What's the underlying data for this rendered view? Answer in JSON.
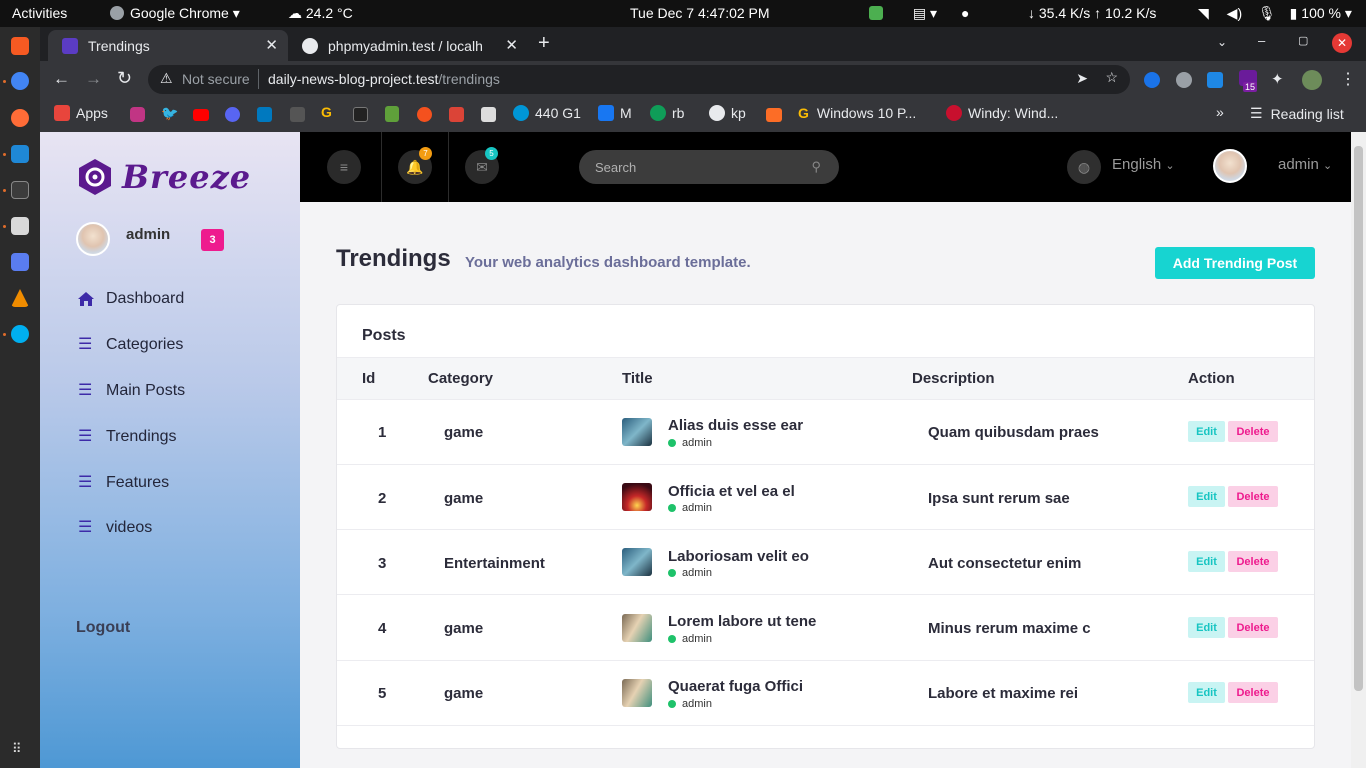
{
  "os_bar": {
    "activities": "Activities",
    "app": "Google Chrome",
    "weather": "24.2 °C",
    "datetime": "Tue Dec 7   4:47:02 PM",
    "net": "↓ 35.4 K/s  ↑  10.2 K/s",
    "battery": "100 %"
  },
  "browser": {
    "tabs": [
      {
        "label": "Trendings",
        "active": true
      },
      {
        "label": "phpmyadmin.test / localh",
        "active": false
      }
    ],
    "url_warning": "Not secure",
    "url_host": "daily-news-blog-project.test",
    "url_path": "/trendings",
    "bookmarks": [
      "Apps",
      "440 G1",
      "M",
      "rb",
      "kp",
      "Windows 10 P...",
      "Windy: Wind..."
    ],
    "reading_list": "Reading list",
    "ext_badge": "15"
  },
  "sidebar": {
    "brand": "Breeze",
    "user": "admin",
    "badge": "3",
    "items": [
      {
        "label": "Dashboard",
        "icon": "home-icon"
      },
      {
        "label": "Categories",
        "icon": "list-icon"
      },
      {
        "label": "Main Posts",
        "icon": "list-icon"
      },
      {
        "label": "Trendings",
        "icon": "list-icon"
      },
      {
        "label": "Features",
        "icon": "list-icon"
      },
      {
        "label": "videos",
        "icon": "list-icon"
      }
    ],
    "logout": "Logout"
  },
  "header": {
    "notif_count": "7",
    "mail_count": "5",
    "search_placeholder": "Search",
    "language": "English",
    "user": "admin"
  },
  "main": {
    "title": "Trendings",
    "subtitle": "Your web analytics dashboard template.",
    "add_button": "Add Trending Post",
    "card_title": "Posts",
    "columns": [
      "Id",
      "Category",
      "Title",
      "Description",
      "Action"
    ],
    "rows": [
      {
        "id": "1",
        "category": "game",
        "title": "Alias duis esse ear",
        "author": "admin",
        "description": "Quam quibusdam praes",
        "edit": "Edit",
        "delete": "Delete"
      },
      {
        "id": "2",
        "category": "game",
        "title": "Officia et vel ea el",
        "author": "admin",
        "description": "Ipsa sunt rerum sae",
        "edit": "Edit",
        "delete": "Delete"
      },
      {
        "id": "3",
        "category": "Entertainment",
        "title": "Laboriosam velit eo",
        "author": "admin",
        "description": "Aut consectetur enim",
        "edit": "Edit",
        "delete": "Delete"
      },
      {
        "id": "4",
        "category": "game",
        "title": "Lorem labore ut tene",
        "author": "admin",
        "description": "Minus rerum maxime c",
        "edit": "Edit",
        "delete": "Delete"
      },
      {
        "id": "5",
        "category": "game",
        "title": "Quaerat fuga Offici",
        "author": "admin",
        "description": "Labore et maxime rei",
        "edit": "Edit",
        "delete": "Delete"
      }
    ]
  },
  "colors": {
    "accent": "#17d4d1",
    "danger": "#ee1b8e",
    "brand": "#5b1a8e"
  }
}
